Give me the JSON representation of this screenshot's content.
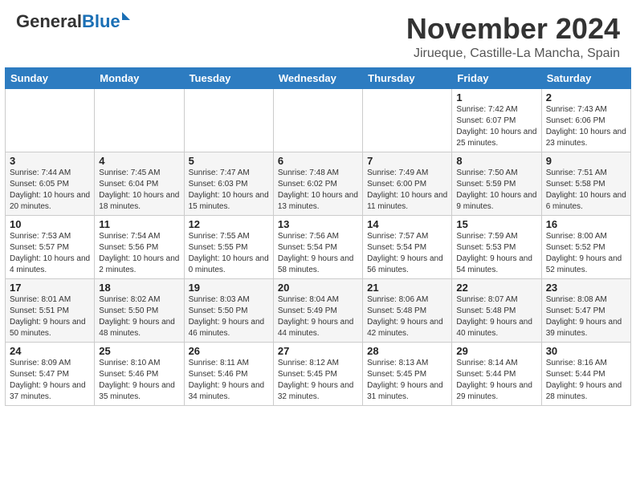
{
  "header": {
    "logo_general": "General",
    "logo_blue": "Blue",
    "month": "November 2024",
    "location": "Jirueque, Castille-La Mancha, Spain"
  },
  "weekdays": [
    "Sunday",
    "Monday",
    "Tuesday",
    "Wednesday",
    "Thursday",
    "Friday",
    "Saturday"
  ],
  "weeks": [
    [
      {
        "day": "",
        "info": ""
      },
      {
        "day": "",
        "info": ""
      },
      {
        "day": "",
        "info": ""
      },
      {
        "day": "",
        "info": ""
      },
      {
        "day": "",
        "info": ""
      },
      {
        "day": "1",
        "info": "Sunrise: 7:42 AM\nSunset: 6:07 PM\nDaylight: 10 hours and 25 minutes."
      },
      {
        "day": "2",
        "info": "Sunrise: 7:43 AM\nSunset: 6:06 PM\nDaylight: 10 hours and 23 minutes."
      }
    ],
    [
      {
        "day": "3",
        "info": "Sunrise: 7:44 AM\nSunset: 6:05 PM\nDaylight: 10 hours and 20 minutes."
      },
      {
        "day": "4",
        "info": "Sunrise: 7:45 AM\nSunset: 6:04 PM\nDaylight: 10 hours and 18 minutes."
      },
      {
        "day": "5",
        "info": "Sunrise: 7:47 AM\nSunset: 6:03 PM\nDaylight: 10 hours and 15 minutes."
      },
      {
        "day": "6",
        "info": "Sunrise: 7:48 AM\nSunset: 6:02 PM\nDaylight: 10 hours and 13 minutes."
      },
      {
        "day": "7",
        "info": "Sunrise: 7:49 AM\nSunset: 6:00 PM\nDaylight: 10 hours and 11 minutes."
      },
      {
        "day": "8",
        "info": "Sunrise: 7:50 AM\nSunset: 5:59 PM\nDaylight: 10 hours and 9 minutes."
      },
      {
        "day": "9",
        "info": "Sunrise: 7:51 AM\nSunset: 5:58 PM\nDaylight: 10 hours and 6 minutes."
      }
    ],
    [
      {
        "day": "10",
        "info": "Sunrise: 7:53 AM\nSunset: 5:57 PM\nDaylight: 10 hours and 4 minutes."
      },
      {
        "day": "11",
        "info": "Sunrise: 7:54 AM\nSunset: 5:56 PM\nDaylight: 10 hours and 2 minutes."
      },
      {
        "day": "12",
        "info": "Sunrise: 7:55 AM\nSunset: 5:55 PM\nDaylight: 10 hours and 0 minutes."
      },
      {
        "day": "13",
        "info": "Sunrise: 7:56 AM\nSunset: 5:54 PM\nDaylight: 9 hours and 58 minutes."
      },
      {
        "day": "14",
        "info": "Sunrise: 7:57 AM\nSunset: 5:54 PM\nDaylight: 9 hours and 56 minutes."
      },
      {
        "day": "15",
        "info": "Sunrise: 7:59 AM\nSunset: 5:53 PM\nDaylight: 9 hours and 54 minutes."
      },
      {
        "day": "16",
        "info": "Sunrise: 8:00 AM\nSunset: 5:52 PM\nDaylight: 9 hours and 52 minutes."
      }
    ],
    [
      {
        "day": "17",
        "info": "Sunrise: 8:01 AM\nSunset: 5:51 PM\nDaylight: 9 hours and 50 minutes."
      },
      {
        "day": "18",
        "info": "Sunrise: 8:02 AM\nSunset: 5:50 PM\nDaylight: 9 hours and 48 minutes."
      },
      {
        "day": "19",
        "info": "Sunrise: 8:03 AM\nSunset: 5:50 PM\nDaylight: 9 hours and 46 minutes."
      },
      {
        "day": "20",
        "info": "Sunrise: 8:04 AM\nSunset: 5:49 PM\nDaylight: 9 hours and 44 minutes."
      },
      {
        "day": "21",
        "info": "Sunrise: 8:06 AM\nSunset: 5:48 PM\nDaylight: 9 hours and 42 minutes."
      },
      {
        "day": "22",
        "info": "Sunrise: 8:07 AM\nSunset: 5:48 PM\nDaylight: 9 hours and 40 minutes."
      },
      {
        "day": "23",
        "info": "Sunrise: 8:08 AM\nSunset: 5:47 PM\nDaylight: 9 hours and 39 minutes."
      }
    ],
    [
      {
        "day": "24",
        "info": "Sunrise: 8:09 AM\nSunset: 5:47 PM\nDaylight: 9 hours and 37 minutes."
      },
      {
        "day": "25",
        "info": "Sunrise: 8:10 AM\nSunset: 5:46 PM\nDaylight: 9 hours and 35 minutes."
      },
      {
        "day": "26",
        "info": "Sunrise: 8:11 AM\nSunset: 5:46 PM\nDaylight: 9 hours and 34 minutes."
      },
      {
        "day": "27",
        "info": "Sunrise: 8:12 AM\nSunset: 5:45 PM\nDaylight: 9 hours and 32 minutes."
      },
      {
        "day": "28",
        "info": "Sunrise: 8:13 AM\nSunset: 5:45 PM\nDaylight: 9 hours and 31 minutes."
      },
      {
        "day": "29",
        "info": "Sunrise: 8:14 AM\nSunset: 5:44 PM\nDaylight: 9 hours and 29 minutes."
      },
      {
        "day": "30",
        "info": "Sunrise: 8:16 AM\nSunset: 5:44 PM\nDaylight: 9 hours and 28 minutes."
      }
    ]
  ]
}
